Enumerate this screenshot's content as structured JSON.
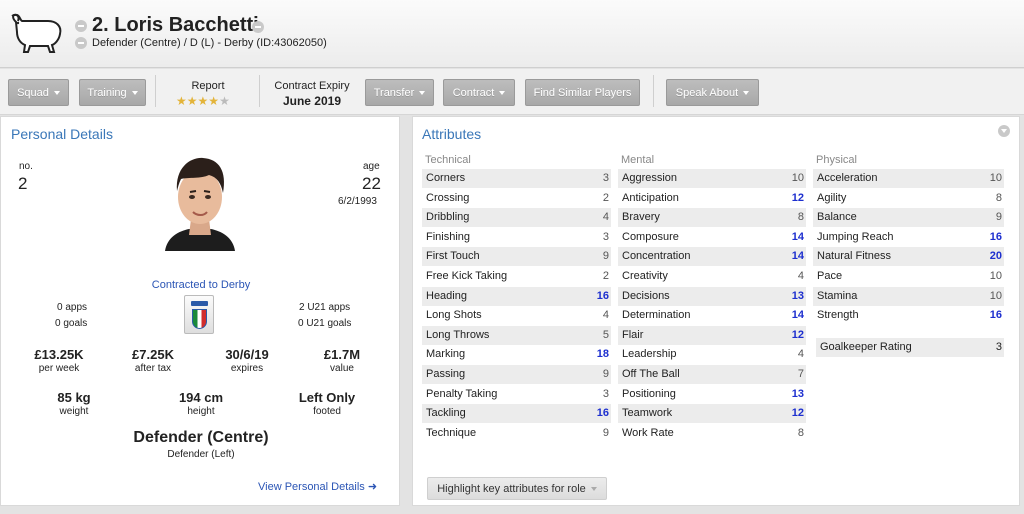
{
  "header": {
    "title": "2. Loris Bacchetti",
    "subtitle": "Defender (Centre) / D (L) - Derby (ID:43062050)"
  },
  "toolbar": {
    "squad": "Squad",
    "training": "Training",
    "report_label": "Report",
    "report_stars": 4,
    "report_max": 5,
    "contract_expiry_label": "Contract Expiry",
    "contract_expiry_value": "June 2019",
    "transfer": "Transfer",
    "contract": "Contract",
    "find_similar": "Find Similar Players",
    "speak_about": "Speak About"
  },
  "personal": {
    "title": "Personal Details",
    "no_label": "no.",
    "no_value": "2",
    "age_label": "age",
    "age_value": "22",
    "dob": "6/2/1993",
    "contracted": "Contracted to Derby",
    "apps": "0 apps",
    "goals": "0 goals",
    "u21_apps": "2 U21 apps",
    "u21_goals": "0 U21 goals",
    "wage": "£13.25K",
    "wage_label": "per week",
    "after_tax": "£7.25K",
    "after_tax_label": "after tax",
    "expires": "30/6/19",
    "expires_label": "expires",
    "value": "£1.7M",
    "value_label": "value",
    "weight": "85 kg",
    "weight_label": "weight",
    "height": "194 cm",
    "height_label": "height",
    "footed": "Left Only",
    "footed_label": "footed",
    "position": "Defender (Centre)",
    "position_sub": "Defender (Left)",
    "view_link": "View Personal Details"
  },
  "attributes": {
    "title": "Attributes",
    "technical_label": "Technical",
    "mental_label": "Mental",
    "physical_label": "Physical",
    "technical": [
      {
        "name": "Corners",
        "value": "3",
        "hl": false
      },
      {
        "name": "Crossing",
        "value": "2",
        "hl": false
      },
      {
        "name": "Dribbling",
        "value": "4",
        "hl": false
      },
      {
        "name": "Finishing",
        "value": "3",
        "hl": false
      },
      {
        "name": "First Touch",
        "value": "9",
        "hl": false
      },
      {
        "name": "Free Kick Taking",
        "value": "2",
        "hl": false
      },
      {
        "name": "Heading",
        "value": "16",
        "hl": true
      },
      {
        "name": "Long Shots",
        "value": "4",
        "hl": false
      },
      {
        "name": "Long Throws",
        "value": "5",
        "hl": false
      },
      {
        "name": "Marking",
        "value": "18",
        "hl": true
      },
      {
        "name": "Passing",
        "value": "9",
        "hl": false
      },
      {
        "name": "Penalty Taking",
        "value": "3",
        "hl": false
      },
      {
        "name": "Tackling",
        "value": "16",
        "hl": true
      },
      {
        "name": "Technique",
        "value": "9",
        "hl": false
      }
    ],
    "mental": [
      {
        "name": "Aggression",
        "value": "10",
        "hl": false
      },
      {
        "name": "Anticipation",
        "value": "12",
        "hl": true
      },
      {
        "name": "Bravery",
        "value": "8",
        "hl": false
      },
      {
        "name": "Composure",
        "value": "14",
        "hl": true
      },
      {
        "name": "Concentration",
        "value": "14",
        "hl": true
      },
      {
        "name": "Creativity",
        "value": "4",
        "hl": false
      },
      {
        "name": "Decisions",
        "value": "13",
        "hl": true
      },
      {
        "name": "Determination",
        "value": "14",
        "hl": true
      },
      {
        "name": "Flair",
        "value": "12",
        "hl": true
      },
      {
        "name": "Leadership",
        "value": "4",
        "hl": false
      },
      {
        "name": "Off The Ball",
        "value": "7",
        "hl": false
      },
      {
        "name": "Positioning",
        "value": "13",
        "hl": true
      },
      {
        "name": "Teamwork",
        "value": "12",
        "hl": true
      },
      {
        "name": "Work Rate",
        "value": "8",
        "hl": false
      }
    ],
    "physical": [
      {
        "name": "Acceleration",
        "value": "10",
        "hl": false
      },
      {
        "name": "Agility",
        "value": "8",
        "hl": false
      },
      {
        "name": "Balance",
        "value": "9",
        "hl": false
      },
      {
        "name": "Jumping Reach",
        "value": "16",
        "hl": true
      },
      {
        "name": "Natural Fitness",
        "value": "20",
        "hl": true
      },
      {
        "name": "Pace",
        "value": "10",
        "hl": false
      },
      {
        "name": "Stamina",
        "value": "10",
        "hl": false
      },
      {
        "name": "Strength",
        "value": "16",
        "hl": true
      }
    ],
    "goalkeeper": {
      "name": "Goalkeeper Rating",
      "value": "3"
    },
    "highlight_button": "Highlight key attributes for role"
  },
  "colors": {
    "link": "#2b55b5",
    "highlight_value": "#1d2fcf",
    "title": "#3a77b8"
  }
}
